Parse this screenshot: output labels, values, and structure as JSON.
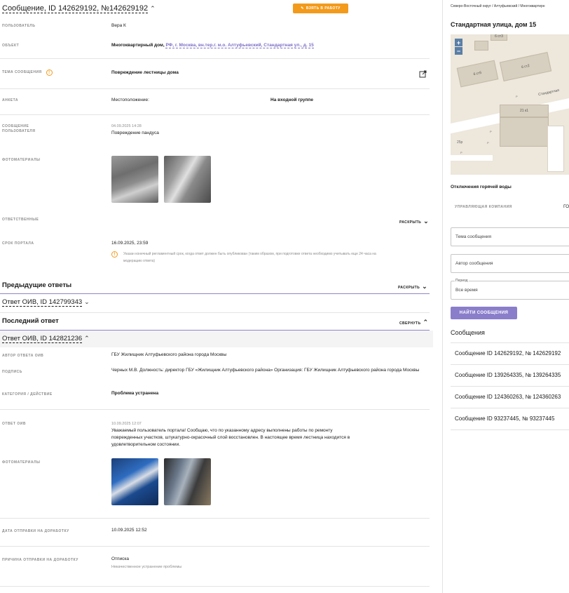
{
  "header": {
    "title": "Сообщение, ID 142629192, №142629192",
    "take_button": "ВЗЯТЬ В РАБОТУ"
  },
  "fields": {
    "user_label": "ПОЛЬЗОВАТЕЛЬ",
    "user_value": "Вера К",
    "object_label": "ОБЪЕКТ",
    "object_prefix": "Многоквартирный дом,",
    "object_link": "РФ, г. Москва, вн.тер.г. м.о. Алтуфьевский, Стандартная ул., д. 15",
    "topic_label": "ТЕМА СООБЩЕНИЯ",
    "topic_value": "Повреждение лестницы дома",
    "survey_label": "АНКЕТА",
    "survey_key": "Местоположение:",
    "survey_value": "На входной группе",
    "message_label": "СООБЩЕНИЕ ПОЛЬЗОВАТЕЛЯ",
    "message_date": "04.09.2025 14:28",
    "message_text": "Повреждение пандуса",
    "photos_label": "ФОТОМАТЕРИАЛЫ",
    "responsible_label": "ОТВЕТСТВЕННЫЕ",
    "expand_label": "РАСКРЫТЬ",
    "deadline_label": "СРОК ПОРТАЛА",
    "deadline_value": "16.09.2025, 23:59",
    "deadline_note": "Указан конечный регламентный срок, когда ответ должен быть опубликован (таким образом, при подготовке ответа необходимо учитывать еще 24 часа на модерацию ответа)"
  },
  "previous": {
    "title": "Предыдущие ответы",
    "toggle": "РАСКРЫТЬ",
    "item": "Ответ ОИВ, ID 142799343"
  },
  "last": {
    "title": "Последний ответ",
    "toggle": "СВЕРНУТЬ",
    "item": "Ответ ОИВ, ID 142821236",
    "author_label": "АВТОР ОТВЕТА ОИВ",
    "author_value": "ГБУ Жилищник Алтуфьевского района города Москвы",
    "sign_label": "ПОДПИСЬ",
    "sign_value": "Черных М.В. Должность: директор ГБУ «Жилищник Алтуфьевского района» Организация: ГБУ Жилищник Алтуфьевского района города Москвы",
    "category_label": "КАТЕГОРИЯ / ДЕЙСТВИЕ",
    "category_value": "Проблема устранена",
    "answer_label": "ОТВЕТ ОИВ",
    "answer_date": "10.09.2025 12:07",
    "answer_text": "Уважаемый пользователь портала! Сообщаю, что по указанному адресу выполнены работы по ремонту поврежденных участков, штукатурно-окрасочный слой восстановлен. В настоящее время лестница находится в удовлетворительном состоянии.",
    "photos_label": "ФОТОМАТЕРИАЛЫ",
    "rework_date_label": "ДАТА ОТПРАВКИ НА ДОРАБОТКУ",
    "rework_date_value": "10.09.2025 12:52",
    "rework_reason_label": "ПРИЧИНА ОТПРАВКИ НА ДОРАБОТКУ",
    "rework_reason_value": "Отписка",
    "rework_reason_sub": "Некачественное устранение проблемы"
  },
  "sidebar": {
    "breadcrumb": "Северо-Восточный округ / Алтуфьевский / Многоквартирн",
    "title": "Стандартная улица, дом 15",
    "map": {
      "zoom_in": "+",
      "zoom_out": "−",
      "labels": [
        "6 ст3",
        "6 ст5",
        "6 ст2",
        "21 к1",
        "Стандартная",
        "25р",
        "Р",
        "Р",
        "Р",
        "Р"
      ]
    },
    "outage": "Отключения горячей воды",
    "mgmt_label": "УПРАВЛЯЮЩАЯ КОМПАНИЯ",
    "mgmt_value": "ГО",
    "topic_placeholder": "Тема сообщения",
    "author_placeholder": "Автор сообщения",
    "period_label": "Период",
    "period_value": "Все время",
    "find_button": "НАЙТИ СООБЩЕНИЯ",
    "messages_title": "Сообщения",
    "messages": [
      "Сообщение ID 142629192, № 142629192",
      "Сообщение ID 139264335, № 139264335",
      "Сообщение ID 124360263, № 124360263",
      "Сообщение ID 93237445, № 93237445"
    ]
  }
}
